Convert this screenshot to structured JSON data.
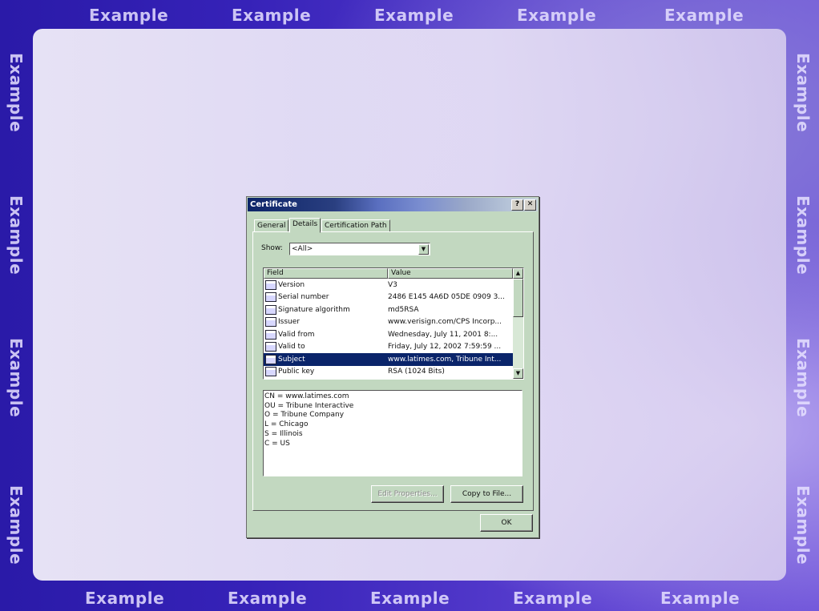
{
  "watermark": "Example",
  "dialog": {
    "title": "Certificate",
    "help_glyph": "?",
    "close_glyph": "✕",
    "tabs": [
      {
        "label": "General"
      },
      {
        "label": "Details"
      },
      {
        "label": "Certification Path"
      }
    ],
    "show_label": "Show:",
    "show_value": "<All>",
    "columns": {
      "field": "Field",
      "value": "Value"
    },
    "rows": [
      {
        "field": "Version",
        "value": "V3"
      },
      {
        "field": "Serial number",
        "value": "2486 E145 4A6D 05DE 0909 3..."
      },
      {
        "field": "Signature algorithm",
        "value": "md5RSA"
      },
      {
        "field": "Issuer",
        "value": "www.verisign.com/CPS Incorp..."
      },
      {
        "field": "Valid from",
        "value": "Wednesday, July 11, 2001 8:..."
      },
      {
        "field": "Valid to",
        "value": "Friday, July 12, 2002 7:59:59 ..."
      },
      {
        "field": "Subject",
        "value": "www.latimes.com, Tribune Int..."
      },
      {
        "field": "Public key",
        "value": "RSA (1024 Bits)"
      }
    ],
    "selected_row": "Subject",
    "detail_lines": [
      "CN = www.latimes.com",
      "OU = Tribune Interactive",
      "O = Tribune Company",
      "L = Chicago",
      "S = Illinois",
      "C = US"
    ],
    "edit_properties_label": "Edit Properties...",
    "copy_to_file_label": "Copy to File...",
    "ok_label": "OK"
  }
}
